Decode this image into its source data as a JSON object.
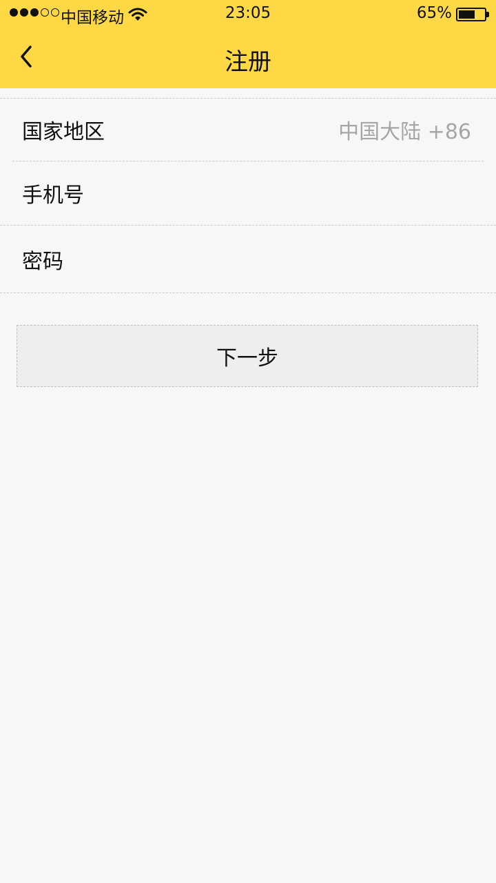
{
  "status_bar": {
    "signal_bars_filled": 3,
    "signal_bars_total": 5,
    "carrier": "中国移动",
    "time": "23:05",
    "battery_percent_text": "65%",
    "battery_level": 0.65
  },
  "nav": {
    "title": "注册",
    "back_icon": "chevron-left-icon"
  },
  "form": {
    "country_label": "国家地区",
    "country_value": "中国大陆 +86",
    "phone_label": "手机号",
    "phone_value": "",
    "password_label": "密码",
    "password_value": ""
  },
  "actions": {
    "next_label": "下一步"
  },
  "colors": {
    "header": "#ffd945",
    "background": "#f7f7f7",
    "button": "#eeeeee",
    "muted_text": "#a6a6a6"
  }
}
